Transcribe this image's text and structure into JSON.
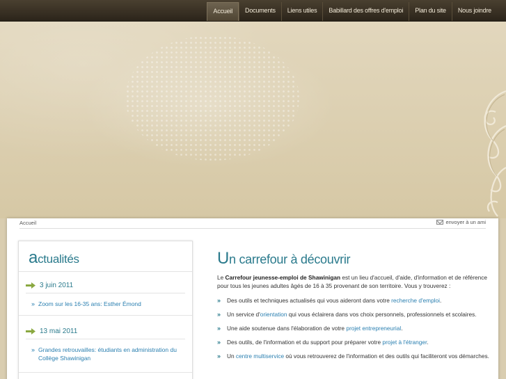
{
  "nav": {
    "items": [
      {
        "label": "Accueil",
        "active": true
      },
      {
        "label": "Documents",
        "active": false
      },
      {
        "label": "Liens utiles",
        "active": false
      },
      {
        "label": "Babillard des offres d'emploi",
        "active": false
      },
      {
        "label": "Plan du site",
        "active": false
      },
      {
        "label": "Nous joindre",
        "active": false
      }
    ]
  },
  "breadcrumb": "Accueil",
  "send_friend": "envoyer à un ami",
  "news": {
    "title_initial": "a",
    "title_rest": "ctualités",
    "items": [
      {
        "date": "3 juin 2011",
        "link": "Zoom sur les 16-35 ans: Esther Émond"
      },
      {
        "date": "13 mai 2011",
        "link": "Grandes retrouvailles: étudiants en administration du Collège Shawinigan"
      }
    ]
  },
  "main": {
    "title_initial": "U",
    "title_rest": "n carrefour à découvrir",
    "intro": {
      "pre": "Le ",
      "bold": "Carrefour jeunesse-emploi de Shawinigan",
      "post": " est un lieu d'accueil, d'aide, d'information et de référence pour tous les jeunes adultes âgés de 16 à 35 provenant de son territoire. Vous y trouverez :"
    },
    "bullets": [
      {
        "pre": "Des outils et techniques actualisés qui vous aideront dans votre ",
        "link": "recherche d'emploi",
        "post": "."
      },
      {
        "pre": "Un service d'",
        "link": "orientation",
        "post": " qui vous éclairera dans vos choix personnels, professionnels et scolaires."
      },
      {
        "pre": "Une aide soutenue dans l'élaboration de votre ",
        "link": "projet entrepreneurial",
        "post": "."
      },
      {
        "pre": "Des outils, de l'information et du support pour préparer votre ",
        "link": "projet à l'étranger",
        "post": "."
      },
      {
        "pre": "Un ",
        "link": "centre multiservice",
        "post": " où vous retrouverez de l'information et des outils qui faciliteront vos démarches."
      }
    ]
  },
  "colors": {
    "accent": "#2a7a8c",
    "link": "#2a7fb0",
    "navbar": "#2b241a",
    "background": "#d9cdb0"
  }
}
